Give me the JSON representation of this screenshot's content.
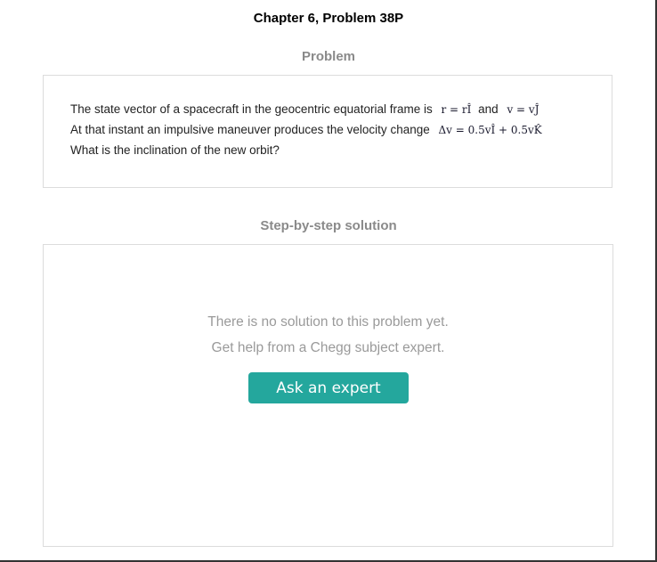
{
  "header": {
    "title": "Chapter 6, Problem 38P"
  },
  "problem": {
    "heading": "Problem",
    "line1_text": "The state vector of a spacecraft in the geocentric equatorial frame is",
    "r_eq": "r = rÎ",
    "and_word": "and",
    "v_eq": "v = vĴ",
    "line2_text": "At that instant an impulsive maneuver produces the velocity change",
    "dv_eq": "Δv = 0.5vÎ + 0.5vK̂",
    "line3_text": "What is the inclination of the new orbit?"
  },
  "solution": {
    "heading": "Step-by-step solution",
    "no_solution_text": "There is no solution to this problem yet.",
    "help_text": "Get help from a Chegg subject expert.",
    "ask_button_label": "Ask an expert",
    "ask_button_color": "#24a79d"
  }
}
